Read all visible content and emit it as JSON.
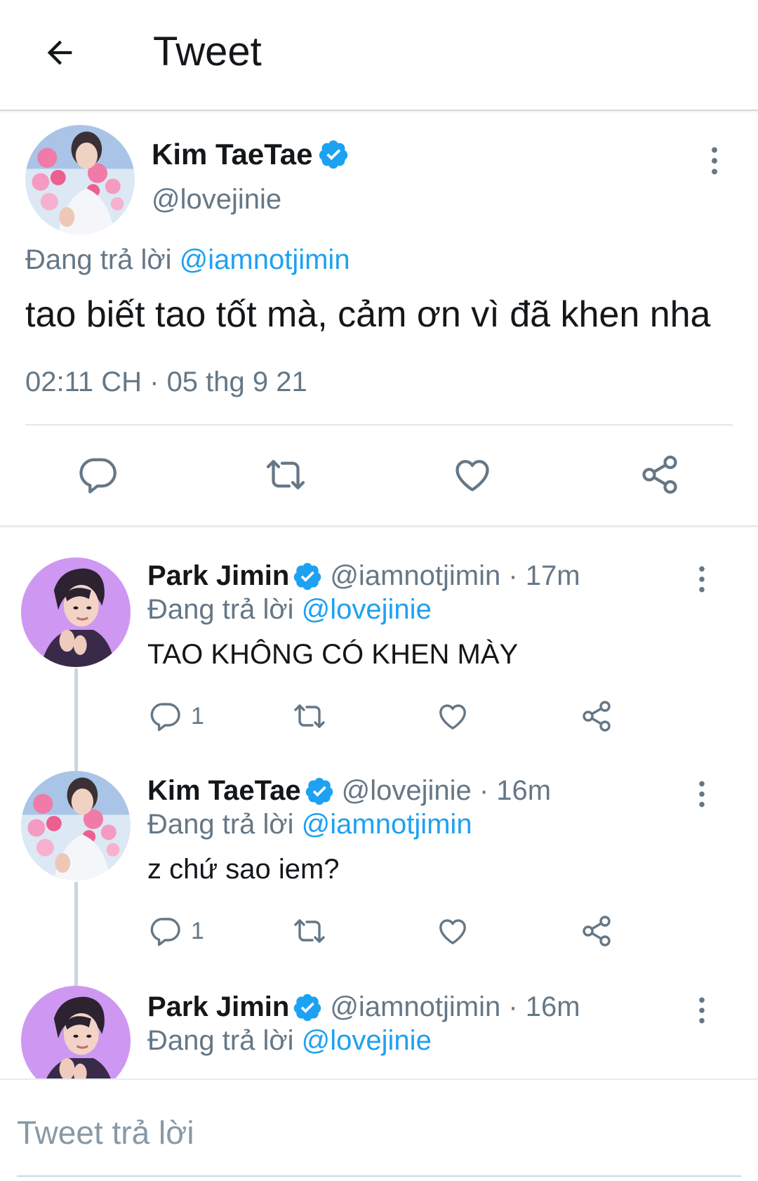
{
  "header": {
    "title": "Tweet"
  },
  "colors": {
    "accent": "#1da1f2",
    "secondary_text": "#657786",
    "jimin_avatar_bg": "#c98ff0"
  },
  "main_tweet": {
    "name": "Kim TaeTae",
    "handle": "@lovejinie",
    "reply_prefix": "Đang trả lời",
    "reply_to": "@iamnotjimin",
    "text": "tao biết tao tốt mà, cảm ơn vì đã khen nha",
    "timestamp": "02:11 CH · 05 thg 9 21"
  },
  "replies": [
    {
      "name": "Park Jimin",
      "handle": "@iamnotjimin · 17m",
      "reply_prefix": "Đang trả lời",
      "reply_to": "@lovejinie",
      "text": "TAO KHÔNG CÓ KHEN MÀY",
      "reply_count": "1"
    },
    {
      "name": "Kim TaeTae",
      "handle": "@lovejinie · 16m",
      "reply_prefix": "Đang trả lời",
      "reply_to": "@iamnotjimin",
      "text": "z chứ sao iem?",
      "reply_count": "1"
    },
    {
      "name": "Park Jimin",
      "handle": "@iamnotjimin · 16m",
      "reply_prefix": "Đang trả lời",
      "reply_to": "@lovejinie"
    }
  ],
  "composer": {
    "placeholder": "Tweet trả lời"
  },
  "icons": [
    "back-arrow-icon",
    "verified-badge-icon",
    "more-options-icon",
    "reply-icon",
    "retweet-icon",
    "like-icon",
    "share-icon"
  ]
}
